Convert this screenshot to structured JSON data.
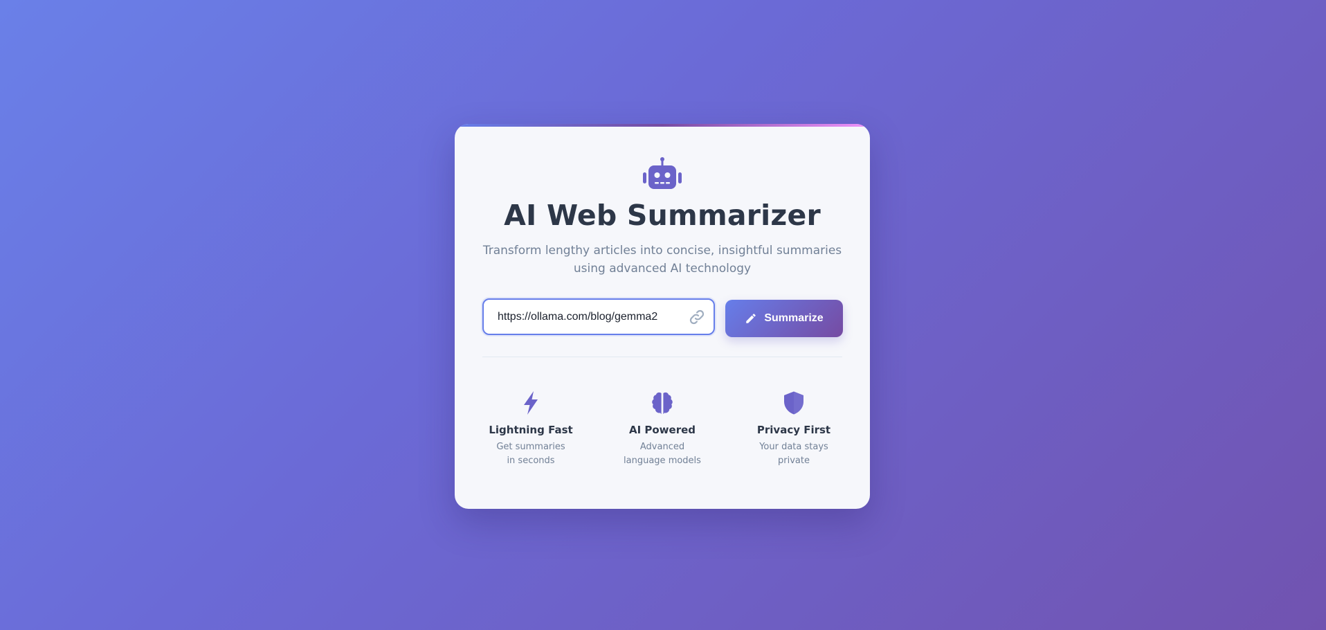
{
  "app": {
    "title": "AI Web Summarizer",
    "subtitle": "Transform lengthy articles into concise, insightful summaries using advanced AI technology"
  },
  "form": {
    "url_value": "https://ollama.com/blog/gemma2",
    "submit_label": "Summarize",
    "input_icon": "link-icon",
    "submit_icon": "pencil-icon"
  },
  "features": [
    {
      "icon": "bolt-icon",
      "title": "Lightning Fast",
      "description": "Get summaries in seconds"
    },
    {
      "icon": "brain-icon",
      "title": "AI Powered",
      "description": "Advanced language models"
    },
    {
      "icon": "shield-icon",
      "title": "Privacy First",
      "description": "Your data stays private"
    }
  ],
  "colors": {
    "accent": "#667eea",
    "accent_dark": "#764ba2",
    "icon": "#6b63c9",
    "heading": "#2d3748",
    "muted": "#718096"
  },
  "logo_icon": "robot-icon"
}
